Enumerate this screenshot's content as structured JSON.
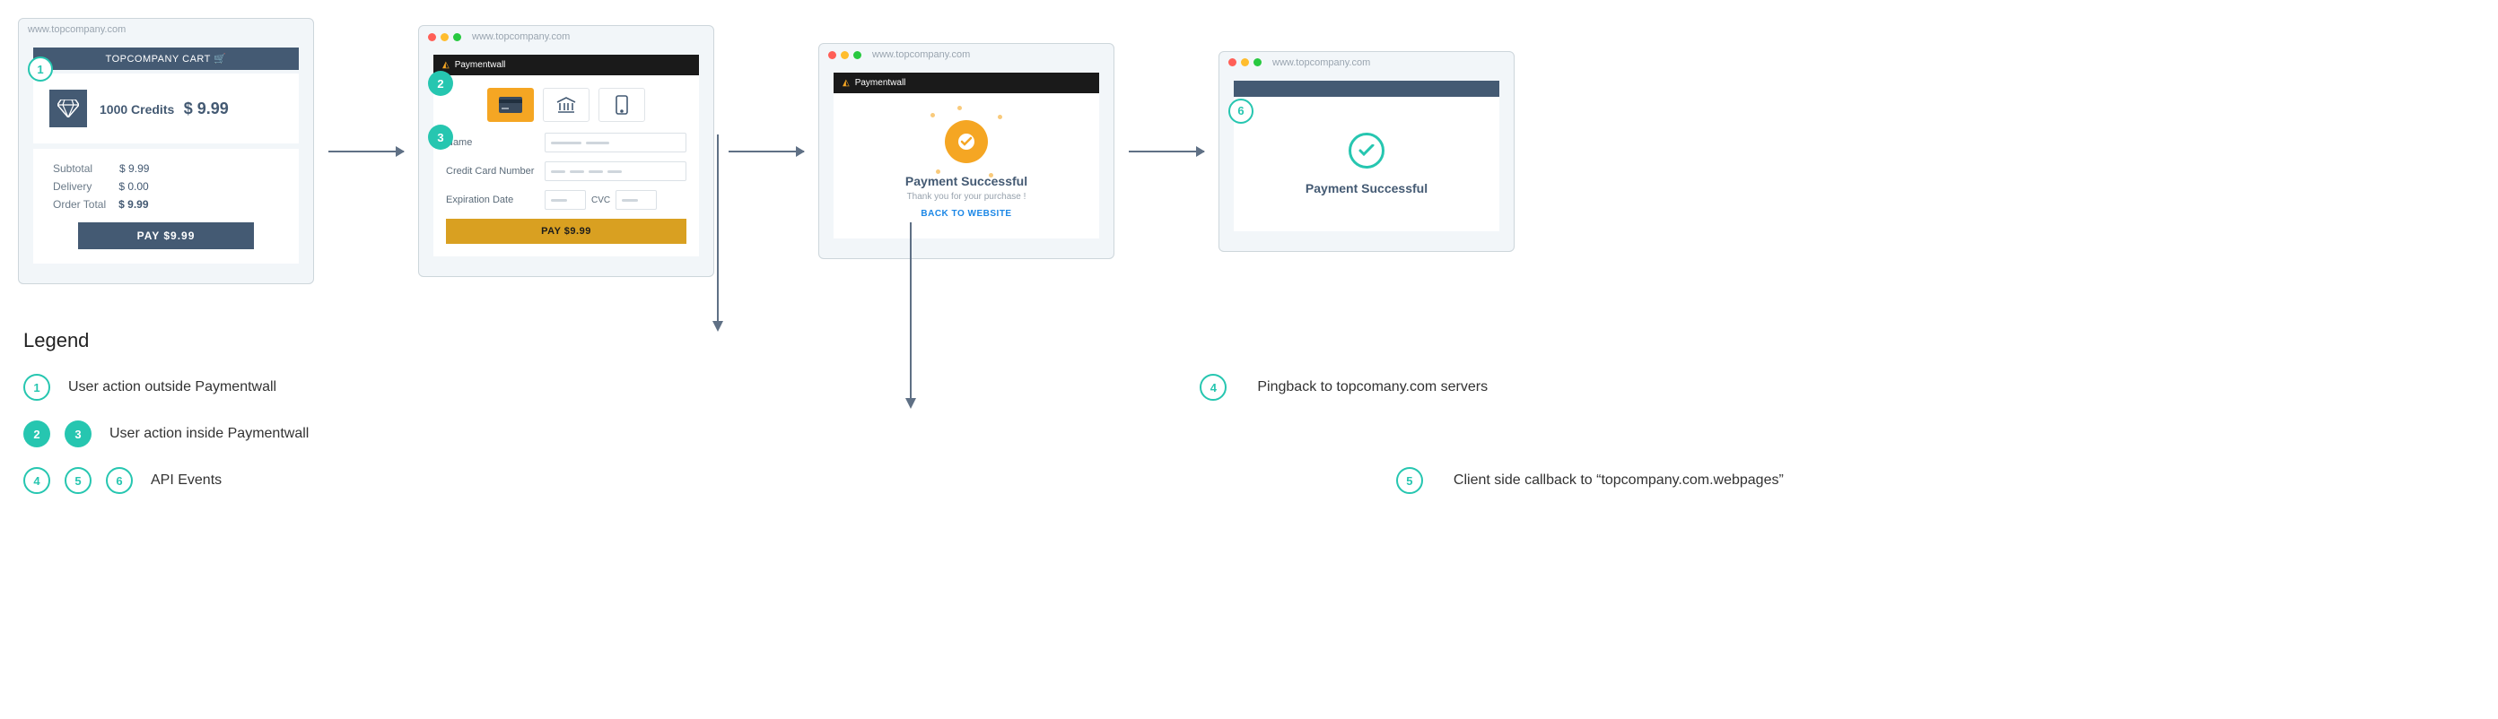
{
  "url": "www.topcompany.com",
  "cart": {
    "header": "TOPCOMPANY CART",
    "product_name": "1000 Credits",
    "product_price": "$ 9.99",
    "rows": {
      "subtotal_label": "Subtotal",
      "subtotal_val": "$ 9.99",
      "delivery_label": "Delivery",
      "delivery_val": "$ 0.00",
      "total_label": "Order Total",
      "total_val": "$ 9.99"
    },
    "pay_label": "PAY $9.99"
  },
  "widget": {
    "brand": "Paymentwall",
    "fields": {
      "name": "Name",
      "ccn": "Credit Card Number",
      "exp": "Expiration Date",
      "cvc": "CVC"
    },
    "pay_label": "PAY $9.99"
  },
  "success_pw": {
    "title": "Payment Successful",
    "sub": "Thank you for your purchase !",
    "back": "BACK TO WEBSITE"
  },
  "success_site": {
    "title": "Payment Successful"
  },
  "legend": {
    "title": "Legend",
    "l1": "User action outside Paymentwall",
    "l2": "User action inside Paymentwall",
    "l3": "API Events",
    "l4": "Pingback to topcomany.com servers",
    "l5": "Client side callback to “topcompany.com.webpages”"
  },
  "steps": {
    "s1": "1",
    "s2": "2",
    "s3": "3",
    "s4": "4",
    "s5": "5",
    "s6": "6"
  }
}
